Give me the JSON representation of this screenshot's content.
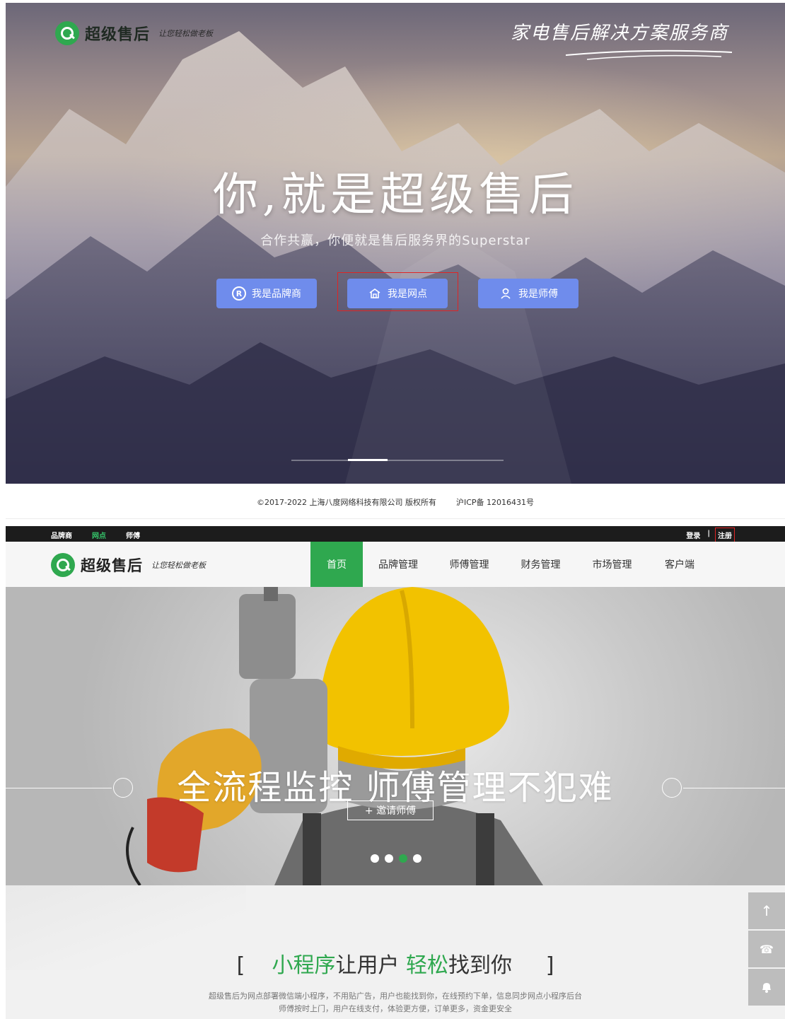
{
  "landing": {
    "logo": {
      "brand": "超级售后",
      "slogan": "让您轻松做老板"
    },
    "tagline": "家电售后解决方案服务商",
    "title": "你,就是超级售后",
    "subtitle": "合作共赢，你便就是售后服务界的Superstar",
    "roles": [
      {
        "label": "我是品牌商",
        "icon": "registered-icon"
      },
      {
        "label": "我是网点",
        "icon": "network-icon"
      },
      {
        "label": "我是师傅",
        "icon": "worker-icon"
      }
    ],
    "copyright": "©2017-2022 上海八度网络科技有限公司 版权所有",
    "icp": "沪ICP备 12016431号"
  },
  "topbar": {
    "roles": [
      "品牌商",
      "网点",
      "师傅"
    ],
    "active_role": "网点",
    "login": "登录",
    "separator": "|",
    "register": "注册"
  },
  "navbar": {
    "logo": {
      "brand": "超级售后",
      "slogan": "让您轻松做老板"
    },
    "items": [
      "首页",
      "品牌管理",
      "师傅管理",
      "财务管理",
      "市场管理",
      "客户端"
    ],
    "active": "首页"
  },
  "banner": {
    "title": "全流程监控 师傅管理不犯难",
    "invite_button": "+ 邀请师傅",
    "dots": 4,
    "active_dot": 3
  },
  "section": {
    "bracket_left": "[",
    "title_parts": [
      "小程序",
      "让用户 ",
      "轻松",
      "找到你"
    ],
    "bracket_right": "]",
    "desc_line1": "超级售后为网点部署微信端小程序，不用贴广告，用户也能找到你，在线预约下单，信息同步网点小程序后台",
    "desc_line2": "师傅按时上门，用户在线支付，体验更方便，订单更多，资金更安全"
  },
  "floating_tools": [
    {
      "icon": "arrow-up-icon",
      "glyph": "↑"
    },
    {
      "icon": "phone-icon",
      "glyph": "☎"
    },
    {
      "icon": "bell-icon",
      "glyph": "🔔"
    }
  ],
  "colors": {
    "brand_green": "#2fa84f",
    "role_button_blue": "#6f8cec",
    "highlight_red": "#e02424",
    "topbar_bg": "#1c1c1c"
  }
}
